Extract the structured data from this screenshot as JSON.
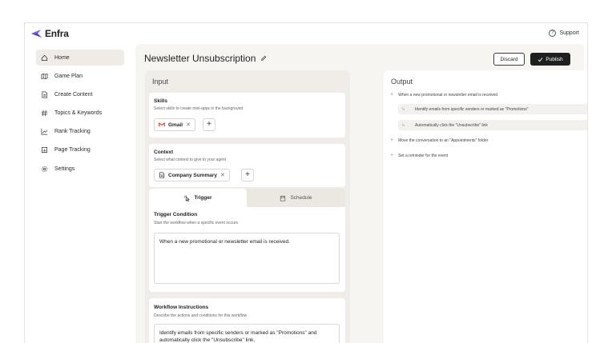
{
  "app": {
    "name": "Enfra"
  },
  "header": {
    "support_label": "Support"
  },
  "sidebar": {
    "items": [
      {
        "label": "Home",
        "icon": "home-icon",
        "active": true
      },
      {
        "label": "Game Plan",
        "icon": "map-icon",
        "active": false
      },
      {
        "label": "Create Content",
        "icon": "document-icon",
        "active": false
      },
      {
        "label": "Topics & Keywords",
        "icon": "hash-icon",
        "active": false
      },
      {
        "label": "Rank Tracking",
        "icon": "chart-icon",
        "active": false
      },
      {
        "label": "Page Tracking",
        "icon": "page-chart-icon",
        "active": false
      },
      {
        "label": "Settings",
        "icon": "gear-icon",
        "active": false
      }
    ]
  },
  "main": {
    "title": "Newsletter Unsubscription",
    "discard_label": "Discard",
    "publish_label": "Publish",
    "input": {
      "title": "Input",
      "skills": {
        "title": "Skills",
        "description": "Select skills to create mini-apps in the background",
        "chip_label": "Gmail"
      },
      "context": {
        "title": "Context",
        "description": "Select what context to give to your agent",
        "chip_label": "Company Summary"
      },
      "tabs": {
        "trigger": "Trigger",
        "schedule": "Schedule"
      },
      "trigger_condition": {
        "title": "Trigger Condition",
        "description": "Start the workflow when a specific event occurs",
        "value": "When a new promotional or newsletter email is received."
      },
      "workflow_instructions": {
        "title": "Workflow Instructions",
        "description": "Describe the actions and conditions for this workflow",
        "value": "Identify emails from specific senders or marked as \"Promotions\" and automatically click the \"Unsubscribe\" link."
      }
    },
    "output": {
      "title": "Output",
      "rows": [
        "When a new promotional or newsletter email is received",
        "Identify emails from specific senders or marked as \"Promotions\"",
        "Automatically click the \"Unsubscribe\" link",
        "Move the conversation to an \"Appointments\" folder",
        "Set a reminder for the event"
      ]
    }
  },
  "colors": {
    "accent": "#7b5cf0",
    "gmail_red": "#d93025",
    "dark": "#1f1f1f"
  }
}
